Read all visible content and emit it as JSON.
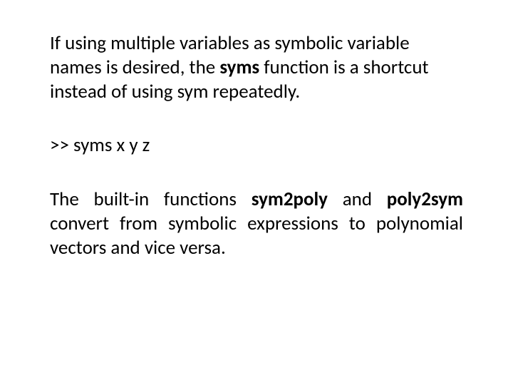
{
  "p1_a": "If using multiple variables as symbolic variable names is desired, the ",
  "p1_b": "syms",
  "p1_c": " function is a shortcut instead of using sym repeatedly.",
  "code": ">> syms x y z",
  "p2_a": "The built-in functions ",
  "p2_b": "sym2poly",
  "p2_c": " and ",
  "p2_d": "poly2sym",
  "p2_e": " convert from symbolic expressions to polynomial vectors and vice versa."
}
